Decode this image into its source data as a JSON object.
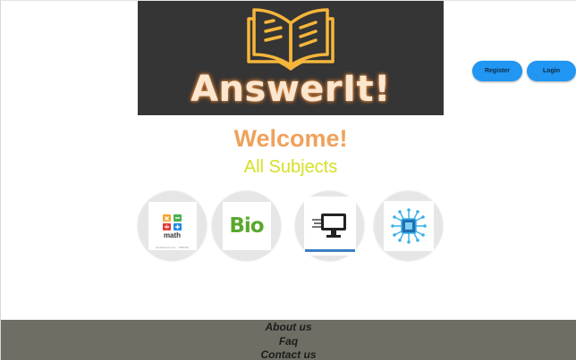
{
  "brand": {
    "logo_text": "AnswerIt!"
  },
  "auth": {
    "register_label": "Register",
    "login_label": "Login"
  },
  "main": {
    "welcome": "Welcome!",
    "subjects_title": "All Subjects",
    "subjects": [
      {
        "label": "math",
        "icon": "math-icon",
        "caption": "shutterstock.com · 1085493"
      },
      {
        "label": "Bio",
        "icon": "bio-icon"
      },
      {
        "label": "",
        "icon": "computer-icon"
      },
      {
        "label": "",
        "icon": "circuit-chip-icon"
      }
    ]
  },
  "footer": {
    "links": [
      "About us",
      "Faq",
      "Contact us"
    ]
  },
  "colors": {
    "accent": "#2196f3",
    "welcome": "#f0a15b",
    "subjects": "#d6e026",
    "footer_bg": "#6e6e64",
    "banner_bg": "#353535"
  }
}
